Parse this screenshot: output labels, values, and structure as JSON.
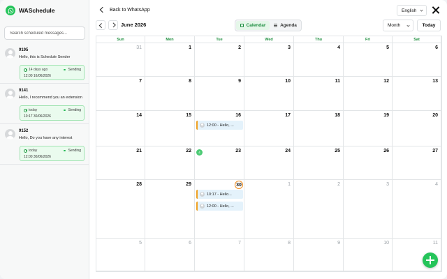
{
  "app": {
    "name": "WASchedule",
    "brand_color": "#25c45a"
  },
  "sidebar": {
    "search_placeholder": "Search scheduled messages...",
    "messages": [
      {
        "name": "9195",
        "text": "Hello, this is Schedule Sender",
        "when": "14 days ago",
        "status": "Sending",
        "date": "12:00 16/06/2026"
      },
      {
        "name": "9141",
        "text": "Hello,  I recommend you an extension",
        "when": "today",
        "status": "Sending",
        "date": "10:17 30/06/2026"
      },
      {
        "name": "9152",
        "text": "Hello, Do you have any interest",
        "when": "today",
        "status": "Sending",
        "date": "12:00 30/06/2026"
      }
    ]
  },
  "header": {
    "back_label": "Back to WhatsApp",
    "language": "English"
  },
  "toolbar": {
    "month_label": "June 2026",
    "views": {
      "calendar": "Calendar",
      "agenda": "Agenda"
    },
    "period": "Month",
    "today_label": "Today"
  },
  "calendar": {
    "weekdays": [
      "Sun",
      "Mon",
      "Tue",
      "Wed",
      "Thu",
      "Fri",
      "Sat"
    ],
    "weeks": [
      [
        {
          "d": "31",
          "out": true
        },
        {
          "d": "1"
        },
        {
          "d": "2"
        },
        {
          "d": "3"
        },
        {
          "d": "4"
        },
        {
          "d": "5"
        },
        {
          "d": "6"
        }
      ],
      [
        {
          "d": "7"
        },
        {
          "d": "8"
        },
        {
          "d": "9"
        },
        {
          "d": "10"
        },
        {
          "d": "11"
        },
        {
          "d": "12"
        },
        {
          "d": "13"
        }
      ],
      [
        {
          "d": "14"
        },
        {
          "d": "15"
        },
        {
          "d": "16",
          "events": [
            "12:00 - Hello, ..."
          ]
        },
        {
          "d": "17"
        },
        {
          "d": "18"
        },
        {
          "d": "19"
        },
        {
          "d": "20"
        }
      ],
      [
        {
          "d": "21"
        },
        {
          "d": "22"
        },
        {
          "d": "23",
          "badge": "4"
        },
        {
          "d": "24"
        },
        {
          "d": "25"
        },
        {
          "d": "26"
        },
        {
          "d": "27"
        }
      ],
      [
        {
          "d": "28"
        },
        {
          "d": "29"
        },
        {
          "d": "30",
          "today": true,
          "events": [
            "10:17 - Hello...",
            "12:00 - Hello, ..."
          ]
        },
        {
          "d": "1",
          "out": true
        },
        {
          "d": "2",
          "out": true
        },
        {
          "d": "3",
          "out": true
        },
        {
          "d": "4",
          "out": true
        }
      ],
      [
        {
          "d": "5",
          "out": true
        },
        {
          "d": "6",
          "out": true
        },
        {
          "d": "7",
          "out": true
        },
        {
          "d": "8",
          "out": true
        },
        {
          "d": "9",
          "out": true
        },
        {
          "d": "10",
          "out": true
        },
        {
          "d": "11",
          "out": true
        }
      ]
    ]
  }
}
